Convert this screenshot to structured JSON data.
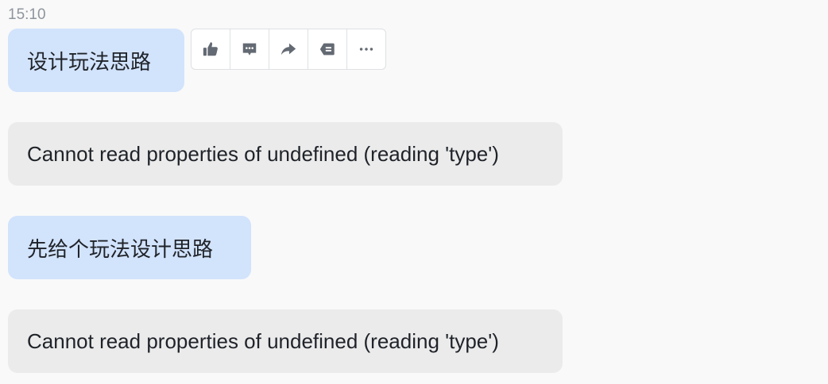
{
  "conversation": {
    "timestamp": "15:10",
    "messages": [
      {
        "role": "user",
        "text": "设计玩法思路"
      },
      {
        "role": "bot",
        "text": "Cannot read properties of undefined (reading 'type')"
      },
      {
        "role": "user",
        "text": "先给个玩法设计思路"
      },
      {
        "role": "bot",
        "text": "Cannot read properties of undefined (reading 'type')"
      }
    ]
  },
  "toolbar": {
    "icons": [
      "thumbs-up-icon",
      "comment-icon",
      "forward-icon",
      "quote-reply-icon",
      "more-icon"
    ],
    "icon_color": "#646a73"
  },
  "colors": {
    "user_bubble": "#d2e3fc",
    "bot_bubble": "#ebebeb",
    "background": "#f9f9f9"
  }
}
